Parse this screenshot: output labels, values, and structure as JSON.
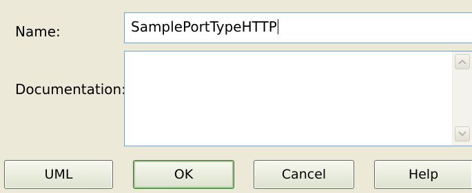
{
  "form": {
    "name_label": "Name:",
    "name_value": "SamplePortTypeHTTP",
    "documentation_label": "Documentation:",
    "documentation_value": ""
  },
  "buttons": {
    "uml": "UML",
    "ok": "OK",
    "cancel": "Cancel",
    "help": "Help"
  },
  "colors": {
    "dialog_background": "#ece9d8",
    "field_border": "#7f9db9",
    "default_button_border": "#3b6d2e"
  }
}
